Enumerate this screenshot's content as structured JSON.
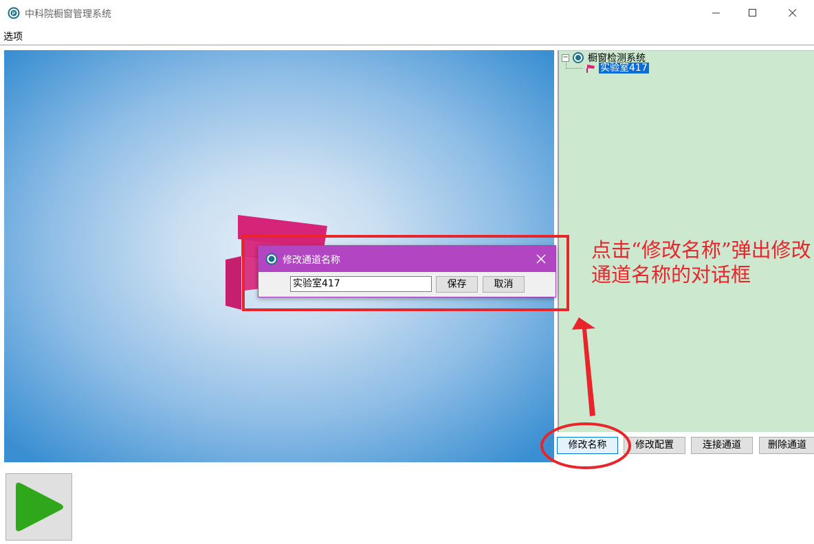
{
  "window": {
    "title": "中科院橱窗管理系统",
    "controls": {
      "minimize": "minimize",
      "maximize": "maximize",
      "close": "close"
    }
  },
  "menu": {
    "items": [
      "选项"
    ]
  },
  "tree": {
    "root_label": "橱窗检测系统",
    "children": [
      {
        "label": "实验室417",
        "selected": true
      }
    ]
  },
  "panel_buttons": {
    "rename": "修改名称",
    "config": "修改配置",
    "connect": "连接通道",
    "delete": "删除通道"
  },
  "dialog": {
    "title": "修改通道名称",
    "input_value": "实验室417",
    "save_label": "保存",
    "cancel_label": "取消"
  },
  "annotation": {
    "line1": "点击“修改名称”弹出修改",
    "line2": "通道名称的对话框",
    "color": "#e8252b"
  },
  "colors": {
    "dialog_title_bg": "#b145c2",
    "tree_bg": "#cce8cf",
    "tree_selected": "#0a6cd6",
    "play_green": "#2ea81a"
  }
}
